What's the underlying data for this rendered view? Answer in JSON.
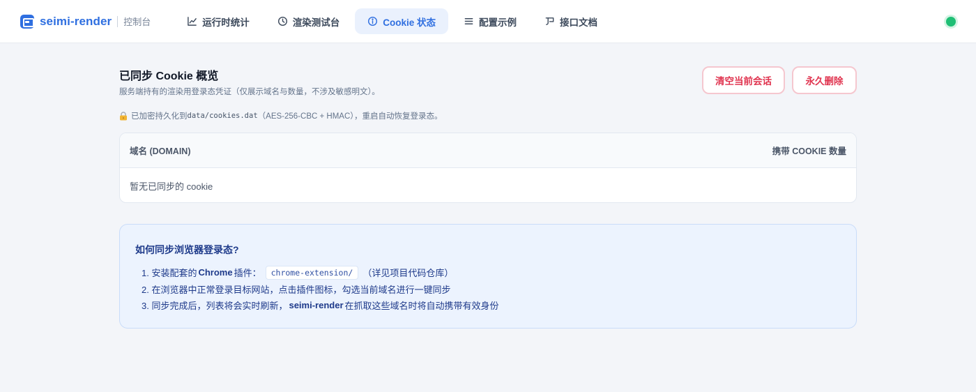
{
  "app": {
    "name": "seimi-render",
    "section": "控制台"
  },
  "nav": {
    "items": [
      {
        "label": "运行时统计",
        "icon": "line-chart-icon"
      },
      {
        "label": "渲染测试台",
        "icon": "clock-icon"
      },
      {
        "label": "Cookie 状态",
        "icon": "info-circle-icon",
        "active": true
      },
      {
        "label": "配置示例",
        "icon": "list-icon"
      },
      {
        "label": "接口文档",
        "icon": "api-doc-icon"
      }
    ]
  },
  "status": {
    "color": "#1fbf75"
  },
  "page": {
    "title": "已同步 Cookie 概览",
    "subtitle": "服务端持有的渲染用登录态凭证（仅展示域名与数量，不涉及敏感明文）。",
    "clear_button": "清空当前会话",
    "delete_button": "永久删除",
    "note": {
      "prefix": "已加密持久化到",
      "path": "data/cookies.dat",
      "suffix": "（AES-256-CBC + HMAC），重启自动恢复登录态。"
    }
  },
  "table": {
    "columns": [
      "域名 (DOMAIN)",
      "携带 COOKIE 数量"
    ],
    "empty": "暂无已同步的 cookie"
  },
  "help": {
    "title": "如何同步浏览器登录态?",
    "step1": {
      "prefix": "1. 安装配套的",
      "strong": "Chrome",
      "mid": "插件：",
      "code": "chrome-extension/",
      "suffix": "（详见项目代码仓库）"
    },
    "step2": {
      "text": "2. 在浏览器中正常登录目标网站，点击插件图标，勾选当前域名进行一键同步"
    },
    "step3": {
      "prefix": "3. 同步完成后，列表将会实时刷新，",
      "strong": "seimi-render",
      "suffix": "在抓取这些域名时将自动携带有效身份"
    }
  },
  "colors": {
    "accent": "#2f6fe0",
    "danger": "#e0344f",
    "help_bg": "#ecf3fe"
  }
}
